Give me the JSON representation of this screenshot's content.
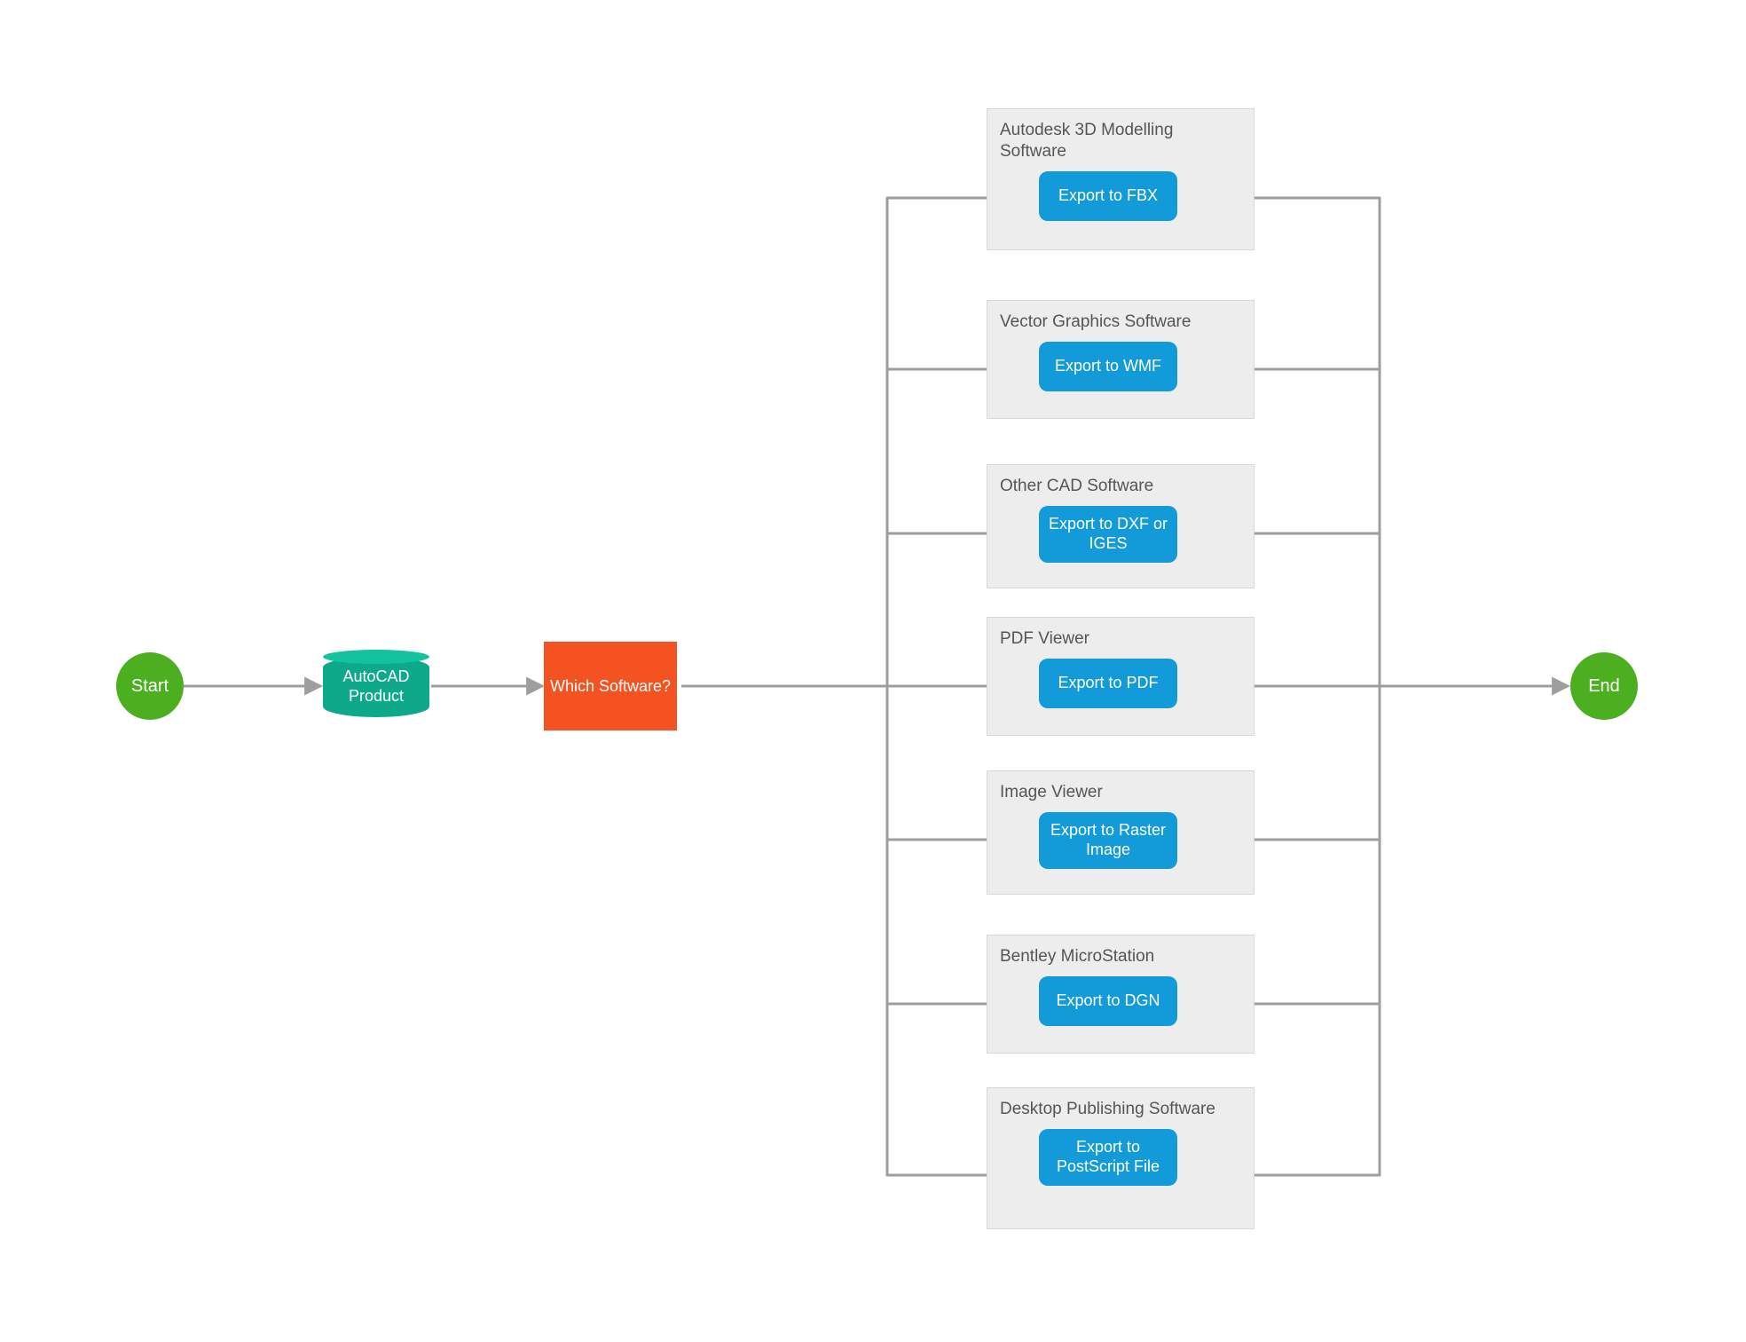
{
  "start": {
    "label": "Start"
  },
  "end": {
    "label": "End"
  },
  "datasource": {
    "label": "AutoCAD\nProduct"
  },
  "decision": {
    "label": "Which Software?"
  },
  "groups": [
    {
      "title": "Autodesk 3D Modelling Software",
      "action": "Export to FBX"
    },
    {
      "title": "Vector Graphics Software",
      "action": "Export to WMF"
    },
    {
      "title": "Other CAD Software",
      "action": "Export to DXF or IGES"
    },
    {
      "title": "PDF Viewer",
      "action": "Export to PDF"
    },
    {
      "title": "Image Viewer",
      "action": "Export to Raster Image"
    },
    {
      "title": "Bentley MicroStation",
      "action": "Export to DGN"
    },
    {
      "title": "Desktop Publishing Software",
      "action": "Export to PostScript File"
    }
  ],
  "colors": {
    "start_end": "#4caf1f",
    "datasource": "#0ea88a",
    "decision": "#f45321",
    "action": "#129bd8",
    "group_bg": "#ededed",
    "arrow": "#9e9e9e"
  }
}
